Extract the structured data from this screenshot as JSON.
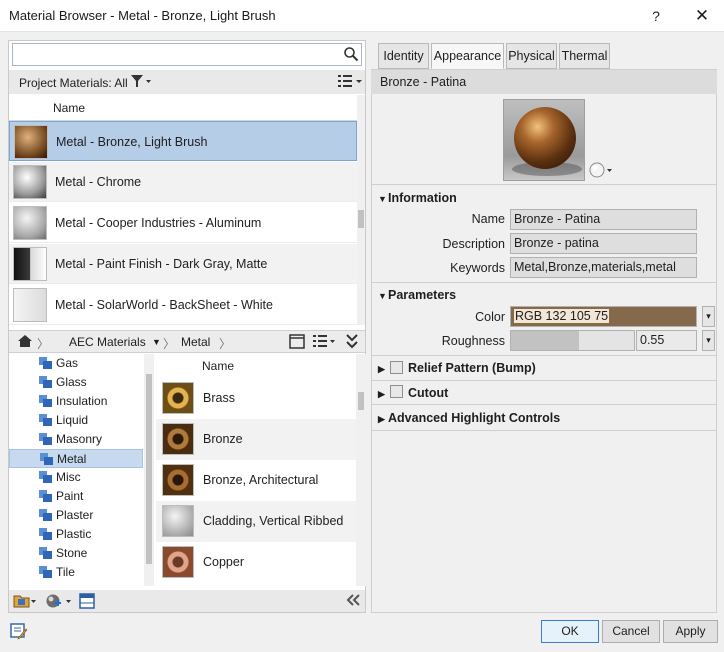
{
  "window": {
    "title": "Material Browser - Metal - Bronze, Light Brush",
    "help_label": "?",
    "close_label": "✕"
  },
  "search": {
    "placeholder": ""
  },
  "project_materials": {
    "label": "Project Materials: All",
    "column_name": "Name",
    "rows": [
      {
        "label": "Metal - Bronze, Light Brush",
        "thumb_color": "#8a5a32",
        "selected": true
      },
      {
        "label": "Metal - Chrome",
        "thumb_color": "#c8c8c8",
        "selected": false
      },
      {
        "label": "Metal - Cooper Industries - Aluminum",
        "thumb_color": "#bcbcbc",
        "selected": false
      },
      {
        "label": "Metal - Paint Finish - Dark Gray, Matte",
        "thumb_color": "#2a2a2a",
        "selected": false
      },
      {
        "label": "Metal - SolarWorld - BackSheet - White",
        "thumb_color": "#e6e6e6",
        "selected": false
      }
    ]
  },
  "breadcrumb": {
    "home_icon": "home-icon",
    "items": [
      "AEC Materials",
      "Metal"
    ]
  },
  "tree": {
    "items": [
      {
        "label": "Gas"
      },
      {
        "label": "Glass"
      },
      {
        "label": "Insulation"
      },
      {
        "label": "Liquid"
      },
      {
        "label": "Masonry"
      },
      {
        "label": "Metal",
        "selected": true
      },
      {
        "label": "Misc"
      },
      {
        "label": "Paint"
      },
      {
        "label": "Plaster"
      },
      {
        "label": "Plastic"
      },
      {
        "label": "Stone"
      },
      {
        "label": "Tile"
      }
    ]
  },
  "library": {
    "column_name": "Name",
    "rows": [
      {
        "label": "Brass",
        "thumb_color": "#b98a2c"
      },
      {
        "label": "Bronze",
        "thumb_color": "#7a4d1e"
      },
      {
        "label": "Bronze, Architectural",
        "thumb_color": "#8a5a26"
      },
      {
        "label": "Cladding, Vertical Ribbed",
        "thumb_color": "#c9c9c9"
      },
      {
        "label": "Copper",
        "thumb_color": "#b06a4b"
      }
    ]
  },
  "tabs": [
    {
      "label": "Identity",
      "active": false
    },
    {
      "label": "Appearance",
      "active": true
    },
    {
      "label": "Physical",
      "active": false
    },
    {
      "label": "Thermal",
      "active": false
    }
  ],
  "asset": {
    "name": "Bronze - Patina"
  },
  "information": {
    "header": "Information",
    "name_label": "Name",
    "name_value": "Bronze - Patina",
    "description_label": "Description",
    "description_value": "Bronze - patina",
    "keywords_label": "Keywords",
    "keywords_value": "Metal,Bronze,materials,metal"
  },
  "parameters": {
    "header": "Parameters",
    "color_label": "Color",
    "color_value": "RGB 132 105 75",
    "color_hex": "#84694b",
    "roughness_label": "Roughness",
    "roughness_value": "0.55",
    "roughness_fraction": 0.55
  },
  "collapsed_sections": {
    "relief": "Relief Pattern (Bump)",
    "cutout": "Cutout",
    "advanced": "Advanced Highlight Controls"
  },
  "buttons": {
    "ok": "OK",
    "cancel": "Cancel",
    "apply": "Apply"
  }
}
